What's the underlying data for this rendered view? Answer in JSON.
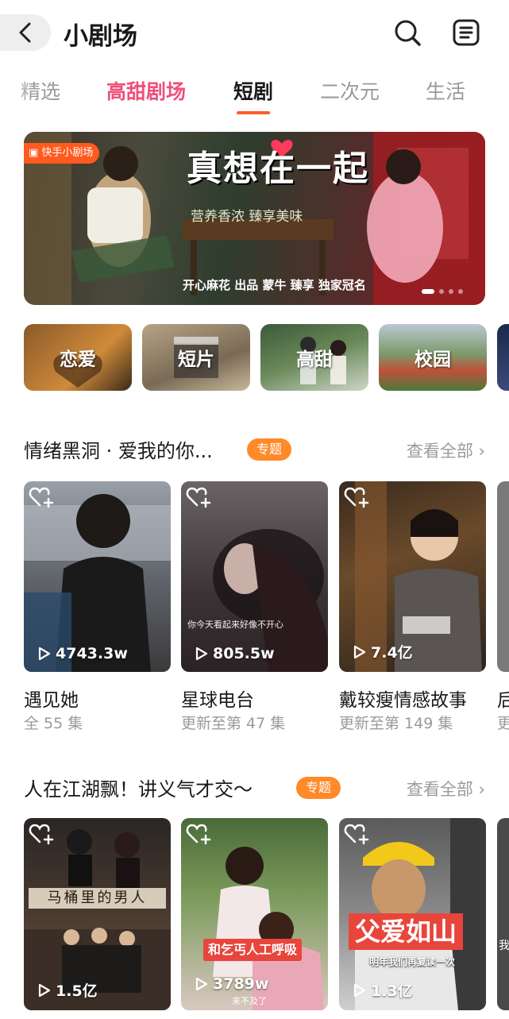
{
  "header": {
    "title": "小剧场",
    "back_icon": "chevron-left-icon",
    "search_icon": "search-icon",
    "menu_icon": "list-menu-icon"
  },
  "tabs": [
    {
      "label": "精选"
    },
    {
      "label": "高甜剧场"
    },
    {
      "label": "短剧",
      "active": true
    },
    {
      "label": "二次元"
    },
    {
      "label": "生活"
    }
  ],
  "banner": {
    "tag": "快手小剧场",
    "title": "真想在一起",
    "subtitle": "营养香浓 臻享美味",
    "sponsor": "开心麻花 出品  蒙牛  臻享 独家冠名",
    "active_slide": 1,
    "slide_count": 5
  },
  "categories": [
    {
      "label": "恋爱"
    },
    {
      "label": "短片"
    },
    {
      "label": "高甜"
    },
    {
      "label": "校园"
    }
  ],
  "section1": {
    "title": "情绪黑洞 · 爱我的你...",
    "badge": "专题",
    "see_all": "查看全部 ›",
    "cards": [
      {
        "views": "4743.3w",
        "name": "遇见她",
        "sub": "全 55 集"
      },
      {
        "views": "805.5w",
        "name": "星球电台",
        "sub": "更新至第 47 集",
        "caption": "你今天看起来好像不开心"
      },
      {
        "views": "7.4亿",
        "name": "戴较瘦情感故事",
        "sub": "更新至第 149 集"
      },
      {
        "name": "后",
        "sub": "更"
      }
    ]
  },
  "section2": {
    "title": "人在江湖飘！讲义气才交～",
    "badge": "专题",
    "see_all": "查看全部 ›",
    "cards": [
      {
        "views": "1.5亿",
        "overlay": "马桶里的男人"
      },
      {
        "views": "3789w",
        "overlay": "和乞丐人工呼吸",
        "bottom": "来不及了"
      },
      {
        "views": "1.3亿",
        "overlay": "父爱如山",
        "small": "明年我们再复读一次"
      },
      {
        "overlay": "我"
      }
    ]
  },
  "colors": {
    "accent": "#ff5b2e",
    "pink_tab": "#f04f7a",
    "badge_orange": "#ff8a2a",
    "muted_text": "#9a9a9a"
  }
}
